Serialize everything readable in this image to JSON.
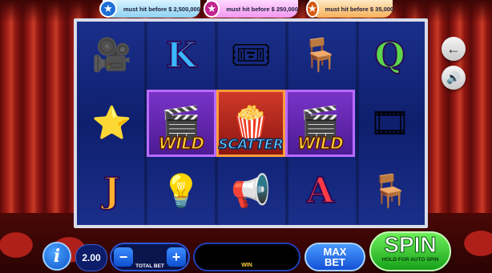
{
  "jackpots": [
    {
      "text": "must hit before $ 2,500,000",
      "color": "#1d6fd6"
    },
    {
      "text": "must hit before $ 250,000",
      "color": "#c2238f"
    },
    {
      "text": "must hit before $ 35,000",
      "color": "#d85b10"
    }
  ],
  "reels": {
    "rows": [
      [
        {
          "symbol": "movie-camera",
          "glyph": "🎥"
        },
        {
          "symbol": "letter-k",
          "glyph": "K"
        },
        {
          "symbol": "cinema-tickets",
          "glyph": "🎟"
        },
        {
          "symbol": "director-chair",
          "glyph": "🪑"
        },
        {
          "symbol": "letter-q",
          "glyph": "Q"
        }
      ],
      [
        {
          "symbol": "star",
          "glyph": "⭐"
        },
        {
          "symbol": "wild-clapperboard",
          "glyph": "🎬",
          "word": "WILD"
        },
        {
          "symbol": "scatter-popcorn",
          "glyph": "🍿",
          "word": "SCATTER"
        },
        {
          "symbol": "wild-clapperboard",
          "glyph": "🎬",
          "word": "WILD"
        },
        {
          "symbol": "film-reel",
          "glyph": "🎞"
        }
      ],
      [
        {
          "symbol": "letter-j",
          "glyph": "J"
        },
        {
          "symbol": "spotlight",
          "glyph": "💡"
        },
        {
          "symbol": "megaphone",
          "glyph": "📢"
        },
        {
          "symbol": "letter-a",
          "glyph": "A"
        },
        {
          "symbol": "director-chair",
          "glyph": "🪑"
        }
      ]
    ]
  },
  "controls": {
    "info_label": "i",
    "bet_value": "2.00",
    "total_bet_label": "TOTAL BET",
    "minus_label": "−",
    "plus_label": "+",
    "win_label": "WIN",
    "max_bet_line1": "MAX",
    "max_bet_line2": "BET",
    "spin_label": "SPIN",
    "spin_sub": "HOLD FOR AUTO SPIN",
    "back_icon": "←",
    "sound_icon": "🔊"
  }
}
